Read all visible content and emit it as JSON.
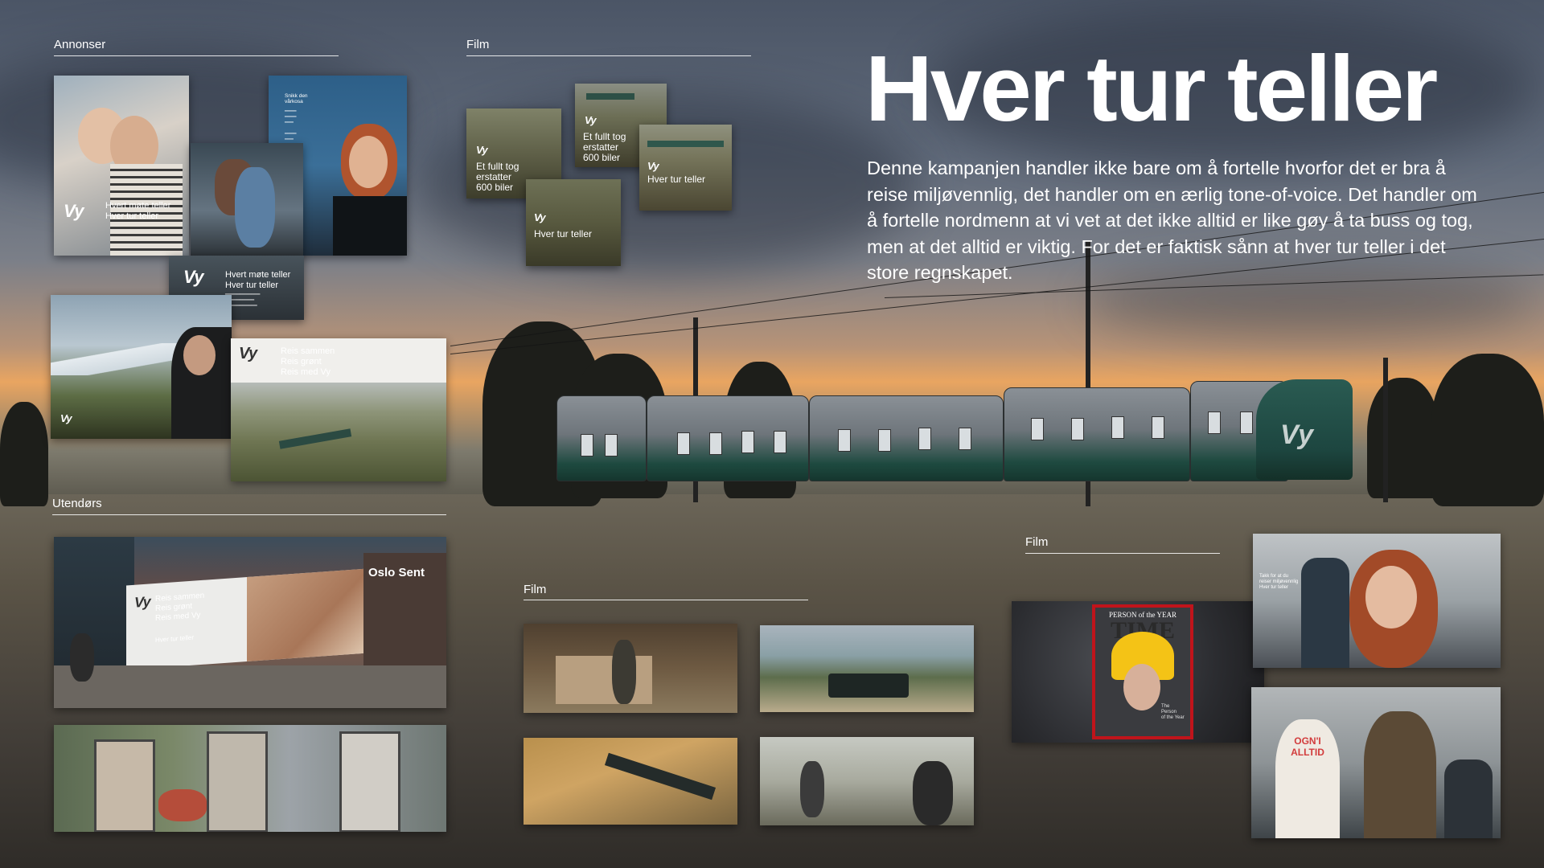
{
  "headline": "Hver tur teller",
  "intro": "Denne kampanjen handler ikke bare om å fortelle hvorfor det er bra å reise miljøvennlig, det handler om en ærlig tone-of-voice. Det handler om å fortelle nordmenn at vi vet at det ikke alltid er like gøy å ta buss og tog, men at det alltid er viktig. For det er faktisk sånn at hver tur teller i det store regnskapet.",
  "sections": {
    "annonser": "Annonser",
    "film_top": "Film",
    "utendors": "Utendørs",
    "film_mid": "Film",
    "film_right": "Film"
  },
  "brand": {
    "logo": "Vy"
  },
  "annonser": {
    "ad1_text": "Hvert møte teller\nHver tur teller",
    "ad2_text": "Hvert møte teller\nHver tur teller",
    "ad3_head": "Snikk den\nvårkosa",
    "ad4_text": "Reis sammen\nReis grønt\nReis med Vy"
  },
  "film_top": {
    "card1": "Et fullt tog\nerstatter\n600 biler",
    "card2": "Et fullt tog\nerstatter\n600 biler",
    "card3": "Hver tur teller",
    "card4": "Hver tur teller"
  },
  "utendors": {
    "billboard_text": "Reis sammen\nReis grønt\nReis med Vy",
    "billboard_sub": "Hver tur teller",
    "station_sign": "Oslo Sent"
  },
  "film_right": {
    "magazine_kicker": "PERSON of the YEAR",
    "magazine_name": "TIME",
    "magazine_small": "The\nPerson\nof the Year",
    "shirt_text": "OGN'I\nALLTID",
    "seat_note": "Takk for at du\nreiser miljøvennlig\nHver tur teller"
  },
  "colors": {
    "vy_green": "#1d4a40",
    "magazine_red": "#c0141b",
    "banana_yellow": "#f4c316"
  }
}
